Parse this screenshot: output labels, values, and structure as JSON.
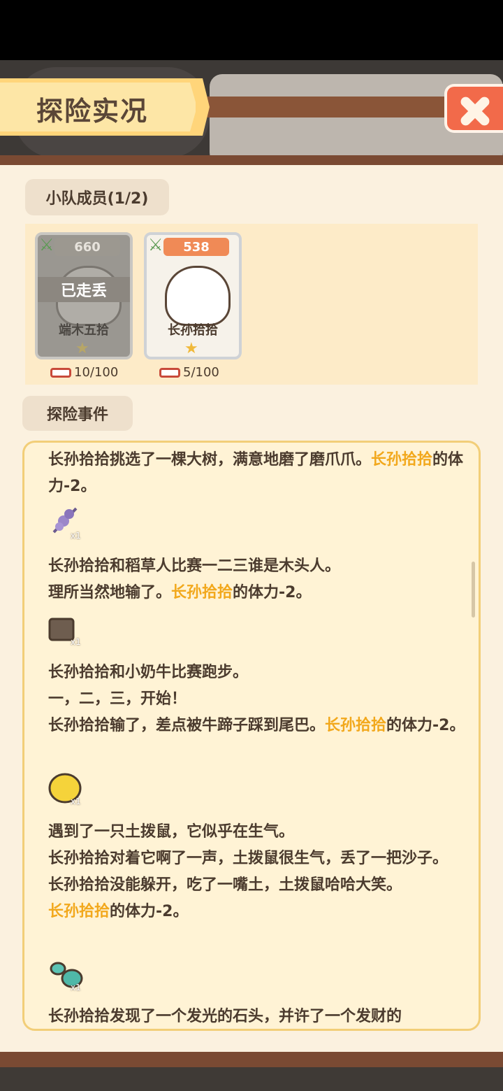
{
  "title": "探险实况",
  "close_icon": "close-x-icon",
  "squad": {
    "label": "小队成员(1/2)",
    "members": [
      {
        "name": "端木五拾",
        "power": "660",
        "status": "已走丢",
        "stamina": "10/100",
        "stars": 1
      },
      {
        "name": "长孙拾拾",
        "power": "538",
        "status": "",
        "stamina": "5/100",
        "stars": 1
      }
    ]
  },
  "events": {
    "label": "探险事件",
    "entries": [
      {
        "pre": "长孙拾拾挑选了一棵大树，满意地磨了磨爪爪。",
        "hl": "长孙拾拾",
        "post": "的体力-2。",
        "item": "lavender-icon",
        "count": "x1"
      },
      {
        "l1": "长孙拾拾和稻草人比赛一二三谁是木头人。",
        "pre": "理所当然地输了。",
        "hl": "长孙拾拾",
        "post": "的体力-2。",
        "item": "paper-bag-icon",
        "count": "x1"
      },
      {
        "l1": "长孙拾拾和小奶牛比赛跑步。",
        "l2": "一，二，三，开始！",
        "pre": "长孙拾拾输了，差点被牛蹄子踩到尾巴。",
        "hl": "长孙拾拾",
        "post": "的体力-2。",
        "item": "lemon-icon",
        "count": "x1"
      },
      {
        "l1": "遇到了一只土拨鼠，它似乎在生气。",
        "l2": "长孙拾拾对着它啊了一声，土拨鼠很生气，丢了一把沙子。",
        "l3": "长孙拾拾没能躲开，吃了一嘴土，土拨鼠哈哈大笑。",
        "hl": "长孙拾拾",
        "post": "的体力-2。",
        "item": "gourd-icon",
        "count": "x1"
      },
      {
        "l1": "长孙拾拾发现了一个发光的石头，并许了一个发财的"
      }
    ]
  }
}
